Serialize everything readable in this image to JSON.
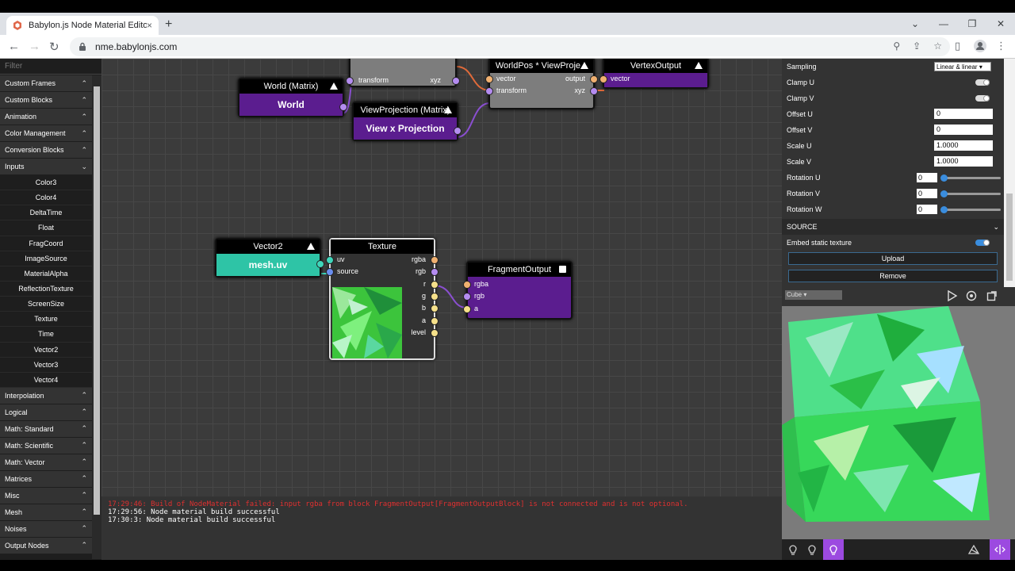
{
  "browser": {
    "tab_title": "Babylon.js Node Material Editor",
    "url": "nme.babylonjs.com",
    "new_tab": "+",
    "tab_close": "×"
  },
  "sidebar": {
    "filter_placeholder": "Filter",
    "top_categories": [
      {
        "label": "Custom Frames"
      },
      {
        "label": "Custom Blocks"
      },
      {
        "label": "Animation"
      },
      {
        "label": "Color Management"
      },
      {
        "label": "Conversion Blocks"
      },
      {
        "label": "Inputs"
      }
    ],
    "input_items": [
      "Color3",
      "Color4",
      "DeltaTime",
      "Float",
      "FragCoord",
      "ImageSource",
      "MaterialAlpha",
      "ReflectionTexture",
      "ScreenSize",
      "Texture",
      "Time",
      "Vector2",
      "Vector3",
      "Vector4"
    ],
    "bottom_categories": [
      {
        "label": "Interpolation"
      },
      {
        "label": "Logical"
      },
      {
        "label": "Math: Standard"
      },
      {
        "label": "Math: Scientific"
      },
      {
        "label": "Math: Vector"
      },
      {
        "label": "Matrices"
      },
      {
        "label": "Misc"
      },
      {
        "label": "Mesh"
      },
      {
        "label": "Noises"
      },
      {
        "label": "Output Nodes"
      }
    ]
  },
  "graph": {
    "nodes": {
      "transform_partial": {
        "ports": {
          "transform": "transform",
          "xyz": "xyz"
        }
      },
      "world_matrix": {
        "title": "World (Matrix)",
        "body": "World"
      },
      "view_projection": {
        "title": "ViewProjection (Matrix)",
        "body": "View x Projection"
      },
      "worldpos_viewproj": {
        "title": "WorldPos * ViewProje...",
        "ports": {
          "vector": "vector",
          "transform": "transform",
          "output": "output",
          "xyz": "xyz"
        }
      },
      "vertex_output": {
        "title": "VertexOutput",
        "ports": {
          "vector": "vector"
        }
      },
      "vector2": {
        "title": "Vector2",
        "body": "mesh.uv"
      },
      "texture": {
        "title": "Texture",
        "ports": {
          "uv": "uv",
          "source": "source",
          "rgba": "rgba",
          "rgb": "rgb",
          "r": "r",
          "g": "g",
          "b": "b",
          "a": "a",
          "level": "level"
        }
      },
      "fragment_output": {
        "title": "FragmentOutput",
        "ports": {
          "rgba": "rgba",
          "rgb": "rgb",
          "a": "a"
        }
      }
    }
  },
  "console": {
    "lines": [
      {
        "type": "error",
        "text": "17:29:46: Build of NodeMaterial failed: input rgba from block FragmentOutput[FragmentOutputBlock] is not connected and is not optional."
      },
      {
        "type": "ok",
        "text": "17:29:56: Node material build successful"
      },
      {
        "type": "ok",
        "text": "17:30:3: Node material build successful"
      }
    ]
  },
  "properties": {
    "sampling": {
      "label": "Sampling",
      "value": "Linear & linear"
    },
    "clamp_u": {
      "label": "Clamp U"
    },
    "clamp_v": {
      "label": "Clamp V"
    },
    "offset_u": {
      "label": "Offset U",
      "value": "0"
    },
    "offset_v": {
      "label": "Offset V",
      "value": "0"
    },
    "scale_u": {
      "label": "Scale U",
      "value": "1.0000"
    },
    "scale_v": {
      "label": "Scale V",
      "value": "1.0000"
    },
    "rotation_u": {
      "label": "Rotation U",
      "value": "0"
    },
    "rotation_v": {
      "label": "Rotation V",
      "value": "0"
    },
    "rotation_w": {
      "label": "Rotation W",
      "value": "0"
    },
    "source_header": "SOURCE",
    "embed_static": {
      "label": "Embed static texture"
    },
    "upload_label": "Upload",
    "remove_label": "Remove"
  },
  "preview": {
    "mesh_select": "Cube"
  },
  "colors": {
    "matrix_node": "#5b1d8f",
    "vector2_node": "#2ec4a6",
    "texture_node": "#323232",
    "accent": "#9c4ae0"
  }
}
